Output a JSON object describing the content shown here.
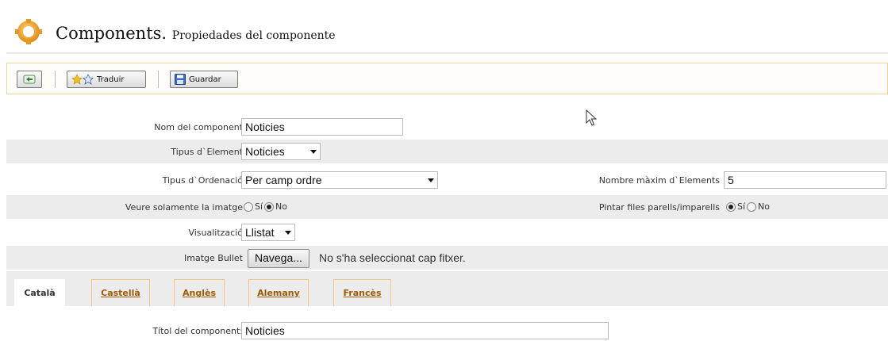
{
  "header": {
    "title": "Components.",
    "subtitle": "Propiedades del componente"
  },
  "toolbar": {
    "translate_label": "Traduir",
    "save_label": "Guardar"
  },
  "form": {
    "component_name": {
      "label": "Nom del component",
      "value": "Noticies"
    },
    "element_type": {
      "label": "Tipus d`Element",
      "value": "Noticies"
    },
    "ordering_type": {
      "label": "Tipus d`Ordenació",
      "value": "Per camp ordre"
    },
    "max_elements": {
      "label": "Nombre màxim d`Elements",
      "value": "5"
    },
    "image_only": {
      "label": "Veure solamente la imatge",
      "yes": "Sí",
      "no": "No",
      "selected": "no"
    },
    "paint_rows": {
      "label": "Pintar files parells/imparells",
      "yes": "Sí",
      "no": "No",
      "selected": "yes"
    },
    "display": {
      "label": "Visualització",
      "value": "Llistat"
    },
    "bullet_image": {
      "label": "Imatge Bullet",
      "button": "Navega...",
      "status": "No s'ha seleccionat cap fitxer."
    }
  },
  "tabs": [
    "Català",
    "Castellà",
    "Anglès",
    "Alemany",
    "Francès"
  ],
  "active_tab": "Català",
  "component_title": {
    "label": "Títol del component:",
    "value": "Noticies"
  },
  "colors": {
    "accent_border": "#f1c58a",
    "tab_link": "#a05a00",
    "shade": "#ececec"
  }
}
